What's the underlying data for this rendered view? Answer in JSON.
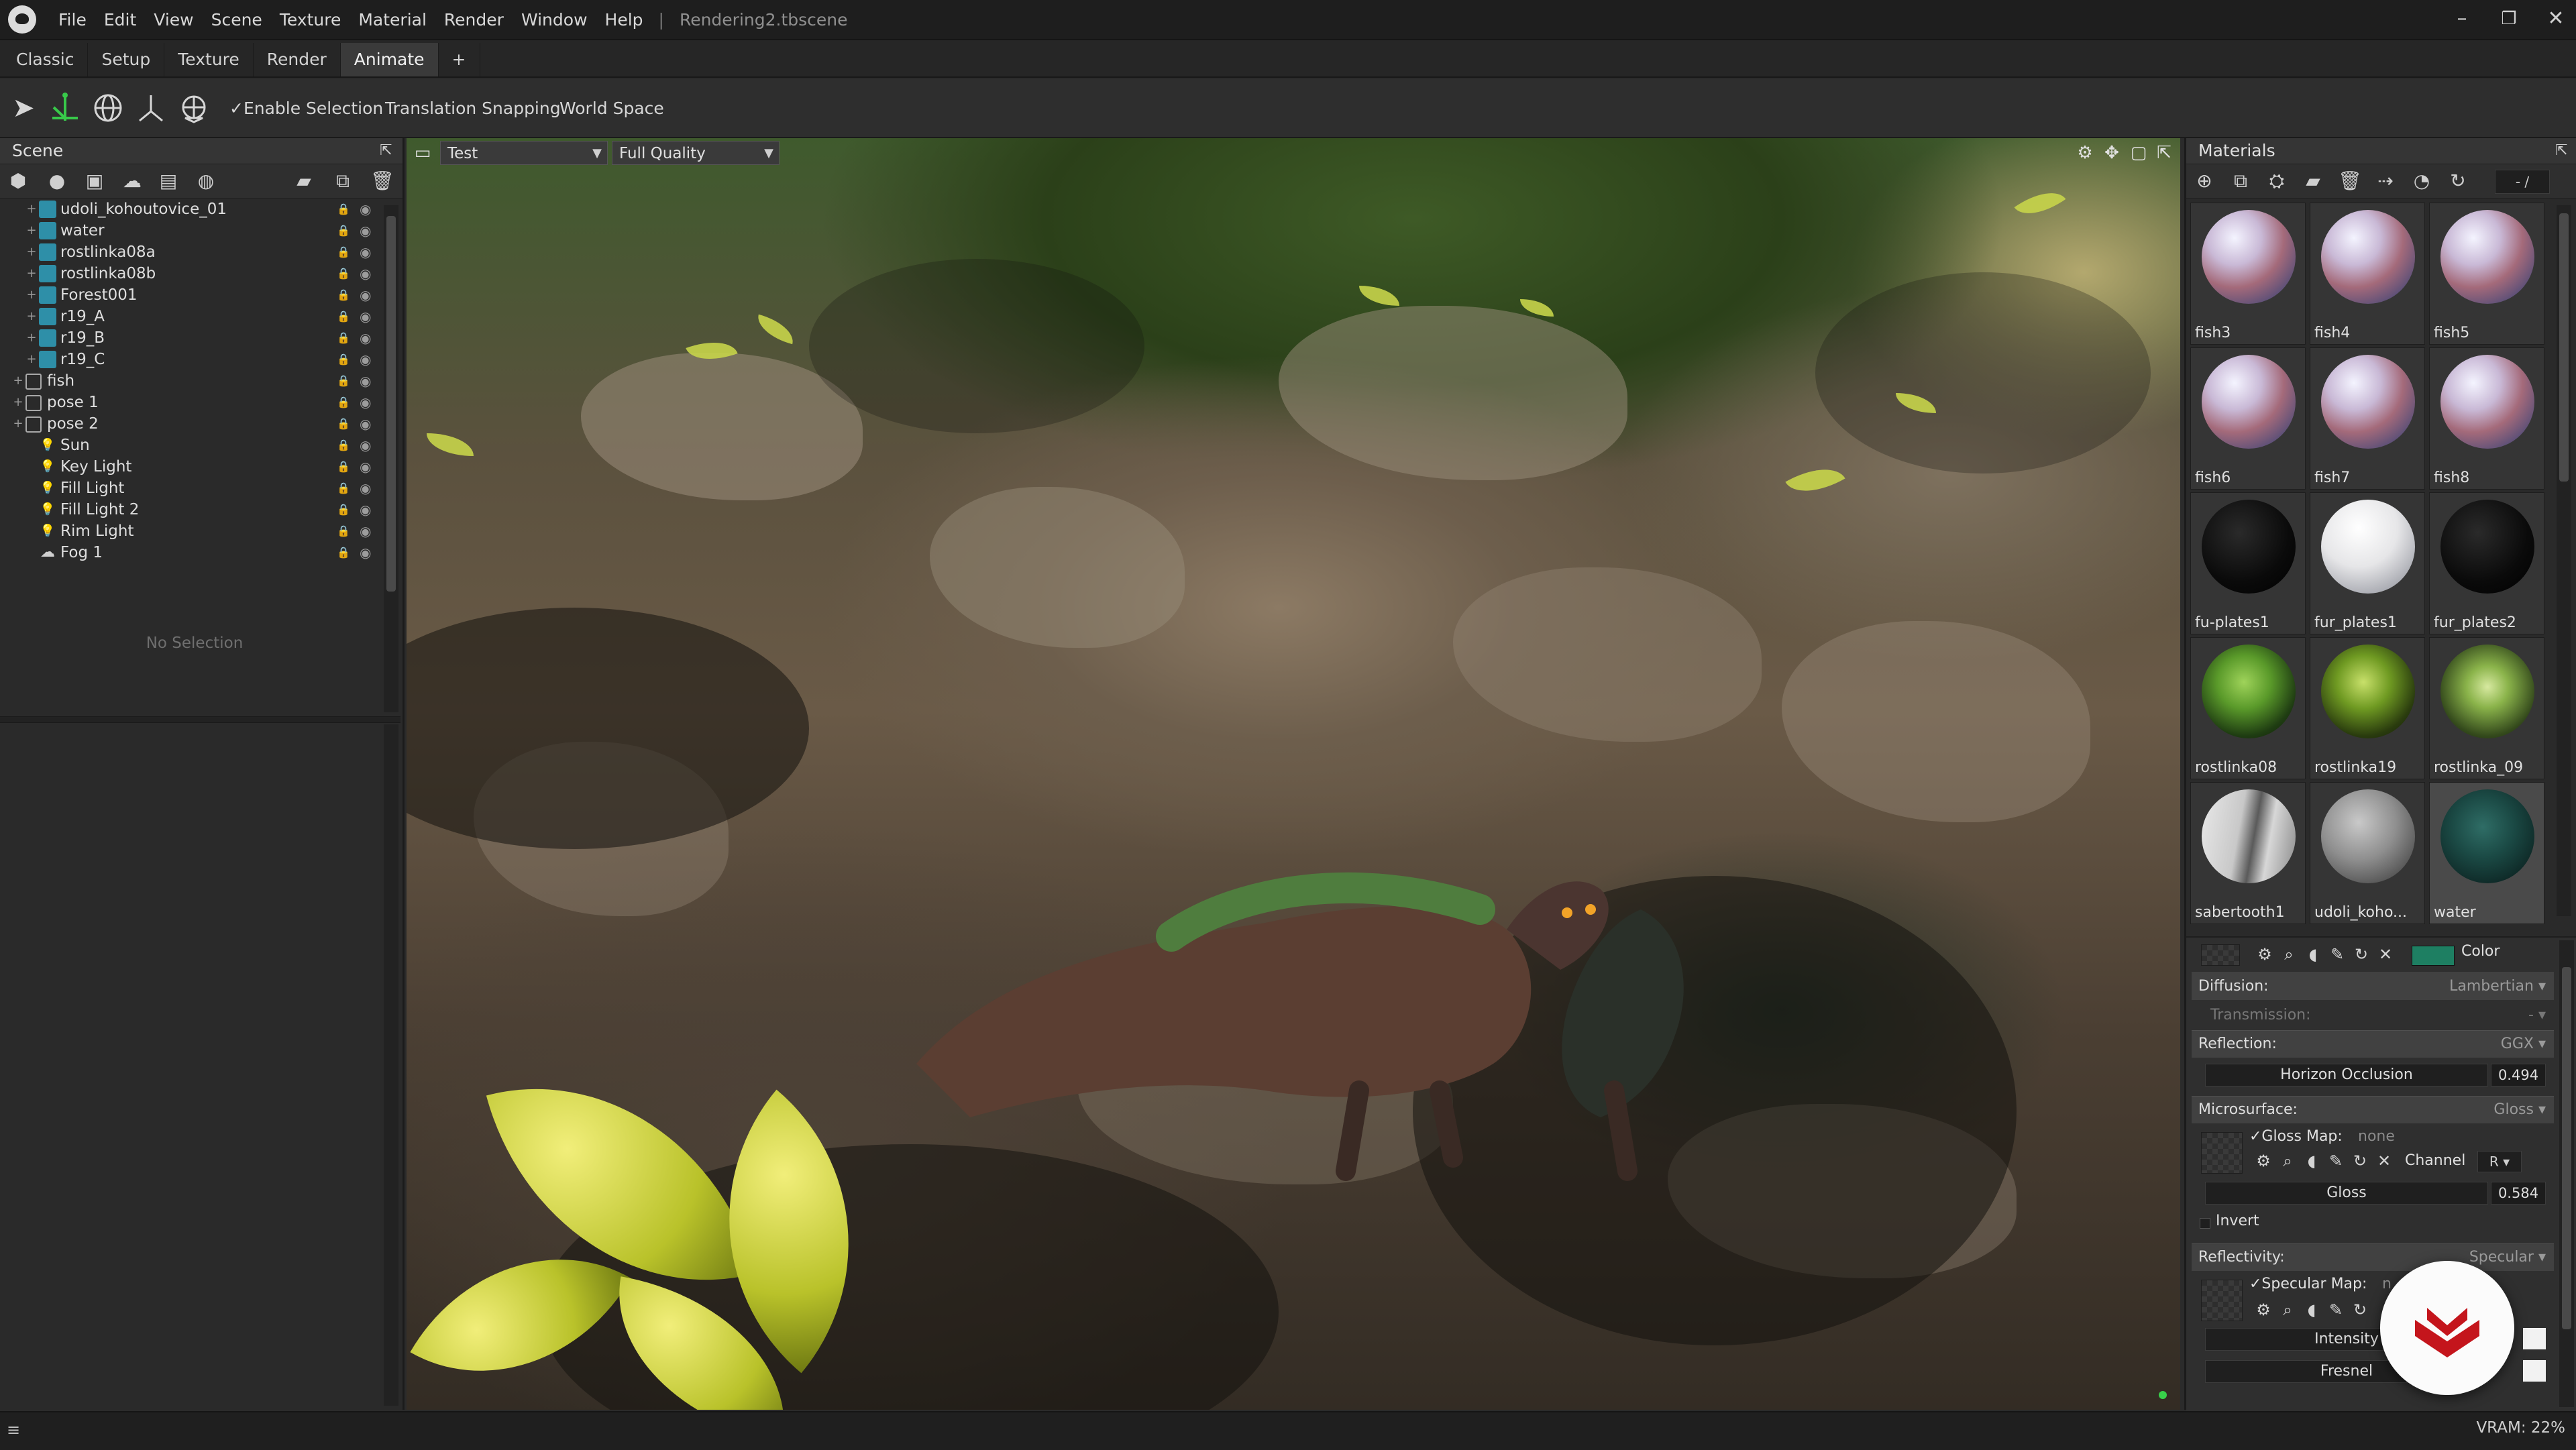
{
  "window": {
    "menu": [
      "File",
      "Edit",
      "View",
      "Scene",
      "Texture",
      "Material",
      "Render",
      "Window",
      "Help"
    ],
    "separator": "|",
    "document": "Rendering2.tbscene",
    "controls": {
      "minimize": "–",
      "maximize": "❐",
      "close": "✕"
    }
  },
  "tabs": [
    "Classic",
    "Setup",
    "Texture",
    "Render",
    "Animate",
    "+"
  ],
  "toolbar": {
    "enable_selection": "✓Enable Selection",
    "translation_snapping": "Translation Snapping",
    "world_space": "World Space"
  },
  "scene": {
    "title": "Scene",
    "items": [
      {
        "label": "udoli_kohoutovice_01",
        "type": "mesh",
        "indent": 1
      },
      {
        "label": "water",
        "type": "mesh",
        "indent": 1
      },
      {
        "label": "rostlinka08a",
        "type": "mesh",
        "indent": 1
      },
      {
        "label": "rostlinka08b",
        "type": "mesh",
        "indent": 1
      },
      {
        "label": "Forest001",
        "type": "mesh",
        "indent": 1
      },
      {
        "label": "r19_A",
        "type": "mesh",
        "indent": 1
      },
      {
        "label": "r19_B",
        "type": "mesh",
        "indent": 1
      },
      {
        "label": "r19_C",
        "type": "mesh",
        "indent": 1
      },
      {
        "label": "fish",
        "type": "group",
        "indent": 0
      },
      {
        "label": "pose 1",
        "type": "group",
        "indent": 0
      },
      {
        "label": "pose 2",
        "type": "group",
        "indent": 0
      },
      {
        "label": "Sun",
        "type": "light",
        "indent": 1
      },
      {
        "label": "Key Light",
        "type": "light",
        "indent": 1
      },
      {
        "label": "Fill Light",
        "type": "light",
        "indent": 1
      },
      {
        "label": "Fill Light 2",
        "type": "light",
        "indent": 1
      },
      {
        "label": "Rim Light",
        "type": "light",
        "indent": 1
      },
      {
        "label": "Fog 1",
        "type": "fog",
        "indent": 1
      }
    ],
    "no_selection": "No Selection"
  },
  "viewport": {
    "camera": "Test",
    "quality": "Full Quality"
  },
  "materials": {
    "title": "Materials",
    "counter": "- /",
    "items": [
      {
        "label": "fish3",
        "kind": "fish"
      },
      {
        "label": "fish4",
        "kind": "fish"
      },
      {
        "label": "fish5",
        "kind": "fish"
      },
      {
        "label": "fish6",
        "kind": "fish"
      },
      {
        "label": "fish7",
        "kind": "fish"
      },
      {
        "label": "fish8",
        "kind": "fish"
      },
      {
        "label": "fu-plates1",
        "kind": "black"
      },
      {
        "label": "fur_plates1",
        "kind": "white"
      },
      {
        "label": "fur_plates2",
        "kind": "black"
      },
      {
        "label": "rostlinka08",
        "kind": "leaf"
      },
      {
        "label": "rostlinka19",
        "kind": "leaf2"
      },
      {
        "label": "rostlinka_09",
        "kind": "leaf3"
      },
      {
        "label": "sabertooth1",
        "kind": "sabertooth"
      },
      {
        "label": "udoli_koho...",
        "kind": "rock"
      },
      {
        "label": "water",
        "kind": "water"
      }
    ],
    "selected": "water",
    "color_label": "Color",
    "accent_color": "#1e7f62",
    "diffusion": {
      "title": "Diffusion:",
      "value": "Lambertian ▾"
    },
    "transmission": {
      "title": "Transmission:",
      "value": "- ▾"
    },
    "reflection": {
      "title": "Reflection:",
      "value": "GGX ▾"
    },
    "horizon_occlusion": {
      "label": "Horizon Occlusion",
      "value": "0.494"
    },
    "microsurface": {
      "title": "Microsurface:",
      "value": "Gloss ▾"
    },
    "gloss_map": {
      "label": "✓Gloss Map:",
      "value": "none"
    },
    "channel": {
      "label": "Channel",
      "value": "R ▾"
    },
    "gloss": {
      "label": "Gloss",
      "value": "0.584"
    },
    "invert": "Invert",
    "reflectivity": {
      "title": "Reflectivity:",
      "value": "Specular ▾"
    },
    "specular_map": {
      "label": "✓Specular Map:",
      "value": "n"
    },
    "intensity": "Intensity",
    "fresnel": "Fresnel"
  },
  "status": {
    "vram": "VRAM: 22%"
  },
  "icons": [
    "app-logo",
    "arrow-select-icon",
    "translate-icon",
    "rotate-icon",
    "scale-icon",
    "pivot-icon",
    "settings-icon",
    "popout-icon"
  ]
}
